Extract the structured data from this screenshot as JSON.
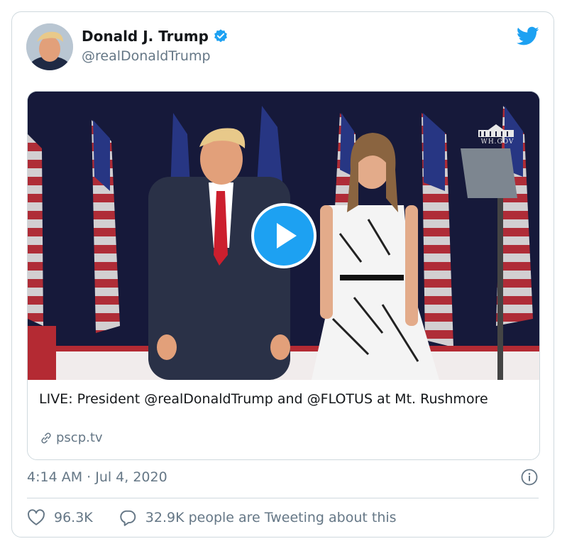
{
  "author": {
    "name": "Donald J. Trump",
    "handle": "@realDonaldTrump"
  },
  "media": {
    "watermark": "WH.GOV",
    "link_title": "LIVE: President @realDonaldTrump and @FLOTUS at Mt. Rushmore",
    "link_domain": "pscp.tv"
  },
  "meta": {
    "timestamp": "4:14 AM · Jul 4, 2020"
  },
  "actions": {
    "likes": "96.3K",
    "conversation": "32.9K people are Tweeting about this"
  },
  "colors": {
    "accent": "#1da1f2",
    "secondary_text": "#657786",
    "border": "#cfd9de"
  },
  "icons": [
    "verified-badge-icon",
    "twitter-bird-icon",
    "play-icon",
    "link-icon",
    "info-icon",
    "heart-icon",
    "reply-bubble-icon"
  ]
}
